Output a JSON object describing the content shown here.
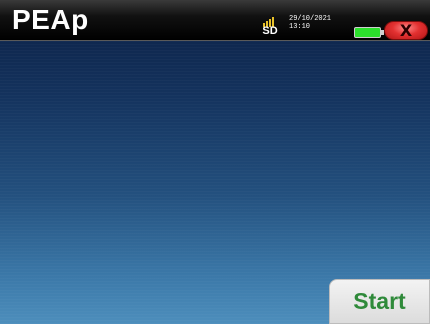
{
  "app": {
    "title": "PEAp"
  },
  "status": {
    "storage_label": "SD",
    "date": "29/10/2021",
    "time": "13:10",
    "battery_icon": "battery-icon",
    "battery_color": "#2ce02c"
  },
  "controls": {
    "close_label": "X",
    "close_color": "#e33131",
    "start_label": "Start",
    "start_color": "#2f8a3a"
  }
}
